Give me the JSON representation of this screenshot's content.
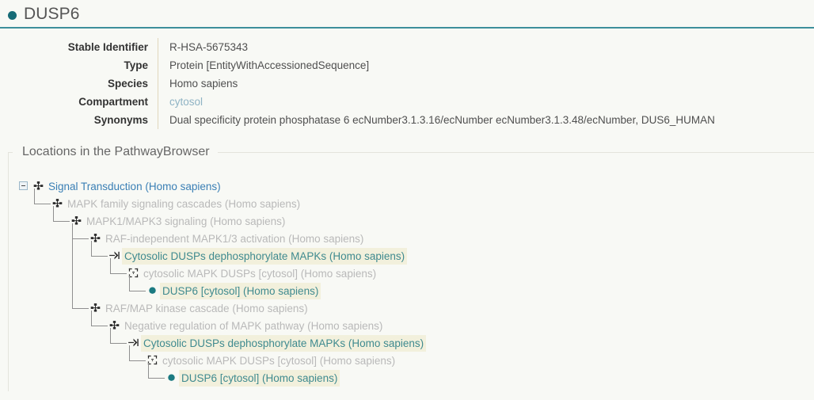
{
  "header": {
    "title": "DUSP6",
    "dot_icon": "filled-circle-icon",
    "accent_color": "#3d8f9b",
    "dot_color": "#166b76"
  },
  "details": {
    "rows": [
      {
        "label": "Stable Identifier",
        "value": "R-HSA-5675343",
        "kind": "text"
      },
      {
        "label": "Type",
        "value": "Protein [EntityWithAccessionedSequence]",
        "kind": "text"
      },
      {
        "label": "Species",
        "value": "Homo sapiens",
        "kind": "text"
      },
      {
        "label": "Compartment",
        "value": "cytosol",
        "kind": "link"
      },
      {
        "label": "Synonyms",
        "value": "Dual specificity protein phosphatase 6 ecNumber3.1.3.16/ecNumber ecNumber3.1.3.48/ecNumber, DUS6_HUMAN",
        "kind": "text"
      }
    ]
  },
  "locations": {
    "legend": "Locations in the PathwayBrowser",
    "tree": [
      {
        "label": "Signal Transduction (Homo sapiens)",
        "icon": "pathway-icon",
        "style": "blue",
        "highlighted": false,
        "depth": 0,
        "toggle": "collapse-toggle"
      },
      {
        "label": "MAPK family signaling cascades (Homo sapiens)",
        "icon": "pathway-icon",
        "style": "dim",
        "highlighted": false,
        "depth": 1
      },
      {
        "label": "MAPK1/MAPK3 signaling (Homo sapiens)",
        "icon": "pathway-icon",
        "style": "dim",
        "highlighted": false,
        "depth": 2
      },
      {
        "label": "RAF-independent MAPK1/3 activation (Homo sapiens)",
        "icon": "pathway-icon",
        "style": "dim",
        "highlighted": false,
        "depth": 3
      },
      {
        "label": "Cytosolic DUSPs dephosphorylate MAPKs (Homo sapiens)",
        "icon": "reaction-icon",
        "style": "teal",
        "highlighted": true,
        "depth": 4
      },
      {
        "label": "cytosolic MAPK DUSPs [cytosol] (Homo sapiens)",
        "icon": "entityset-icon",
        "style": "dim",
        "highlighted": false,
        "depth": 5
      },
      {
        "label": "DUSP6 [cytosol] (Homo sapiens)",
        "icon": "protein-icon",
        "style": "teal",
        "highlighted": true,
        "depth": 6
      },
      {
        "label": "RAF/MAP kinase cascade (Homo sapiens)",
        "icon": "pathway-icon",
        "style": "dim",
        "highlighted": false,
        "depth": 3
      },
      {
        "label": "Negative regulation of MAPK pathway (Homo sapiens)",
        "icon": "pathway-icon",
        "style": "dim",
        "highlighted": false,
        "depth": 4
      },
      {
        "label": "Cytosolic DUSPs dephosphorylate MAPKs (Homo sapiens)",
        "icon": "reaction-icon",
        "style": "teal",
        "highlighted": true,
        "depth": 5
      },
      {
        "label": "cytosolic MAPK DUSPs [cytosol] (Homo sapiens)",
        "icon": "entityset-icon",
        "style": "dim",
        "highlighted": false,
        "depth": 6
      },
      {
        "label": "DUSP6 [cytosol] (Homo sapiens)",
        "icon": "protein-icon",
        "style": "teal",
        "highlighted": true,
        "depth": 7
      }
    ]
  }
}
